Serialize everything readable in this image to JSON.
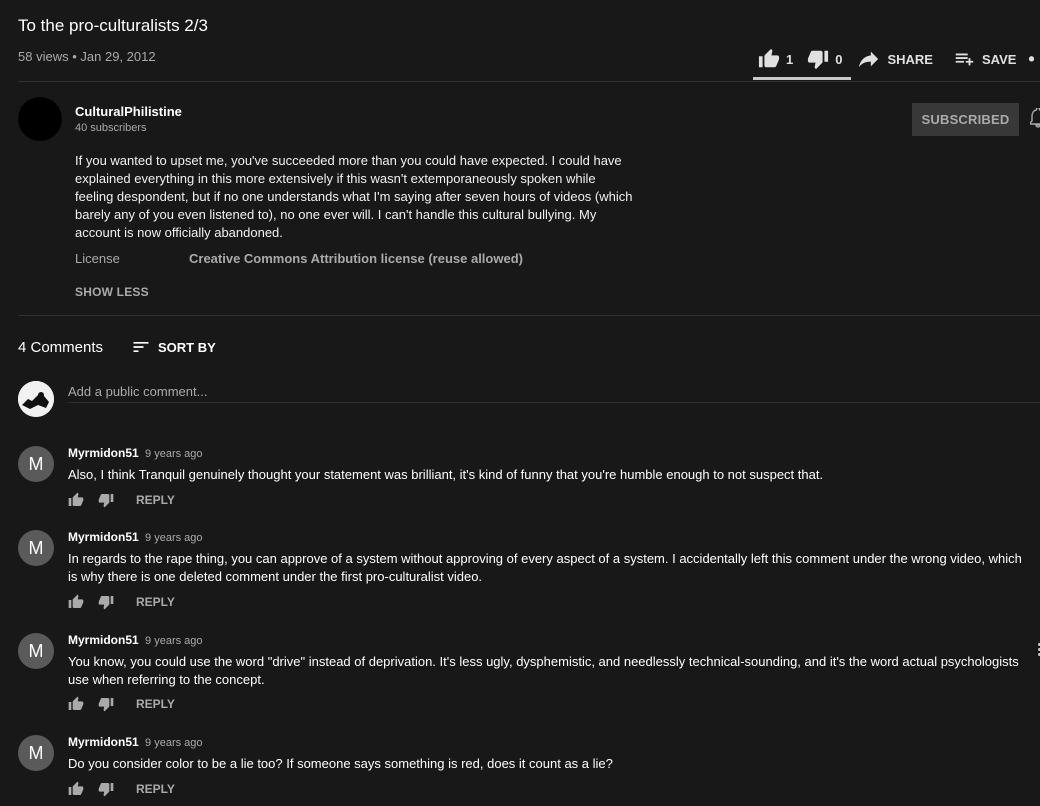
{
  "video": {
    "title": "To the pro-culturalists 2/3",
    "views": "58 views",
    "separator": "•",
    "date": "Jan 29, 2012"
  },
  "actions": {
    "like_count": "1",
    "dislike_count": "0",
    "share_label": "SHARE",
    "save_label": "SAVE",
    "more_label": "• •",
    "like_ratio": 1.0
  },
  "channel": {
    "name": "CulturalPhilistine",
    "subscribers": "40 subscribers",
    "subscribe_label": "SUBSCRIBED"
  },
  "description": {
    "text": "If you wanted to upset me, you've succeeded more than you could have expected. I could have explained everything in this more extensively if this wasn't extemporaneously spoken while feeling despondent, but if no one understands what I'm saying after seven hours of videos (which barely any of you even listened to), no one ever will. I can't handle this cultural bullying. My account is now officially abandoned.",
    "license_label": "License",
    "license_value": "Creative Commons Attribution license (reuse allowed)",
    "show_less_label": "SHOW LESS"
  },
  "comments_section": {
    "count_label": "4 Comments",
    "sort_label": "SORT BY",
    "add_placeholder": "Add a public comment...",
    "reply_label": "REPLY",
    "items": [
      {
        "initial": "M",
        "author": "Myrmidon51",
        "time": "9 years ago",
        "text": "Also, I think Tranquil genuinely thought your statement was brilliant, it's kind of funny that you're humble enough to not suspect that."
      },
      {
        "initial": "M",
        "author": "Myrmidon51",
        "time": "9 years ago",
        "text": "In regards to the rape thing, you can approve of a system without approving of every aspect of a system. I accidentally left this comment under the wrong video, which is why there is one deleted comment under the first pro-culturalist video."
      },
      {
        "initial": "M",
        "author": "Myrmidon51",
        "time": "9 years ago",
        "text": "You know, you could use the word \"drive\" instead of deprivation. It's less ugly, dysphemistic, and needlessly technical-sounding, and it's the word actual psychologists use when referring to the concept."
      },
      {
        "initial": "M",
        "author": "Myrmidon51",
        "time": "9 years ago",
        "text": "Do you consider color to be a lie too? If someone says something is red, does it count as a lie?"
      }
    ]
  },
  "icons": {
    "like": "thumb-up-icon",
    "dislike": "thumb-down-icon",
    "share": "share-arrow-icon",
    "save": "playlist-add-icon",
    "sort": "sort-lines-icon",
    "bell": "bell-icon",
    "more": "more-horizontal-icon"
  }
}
